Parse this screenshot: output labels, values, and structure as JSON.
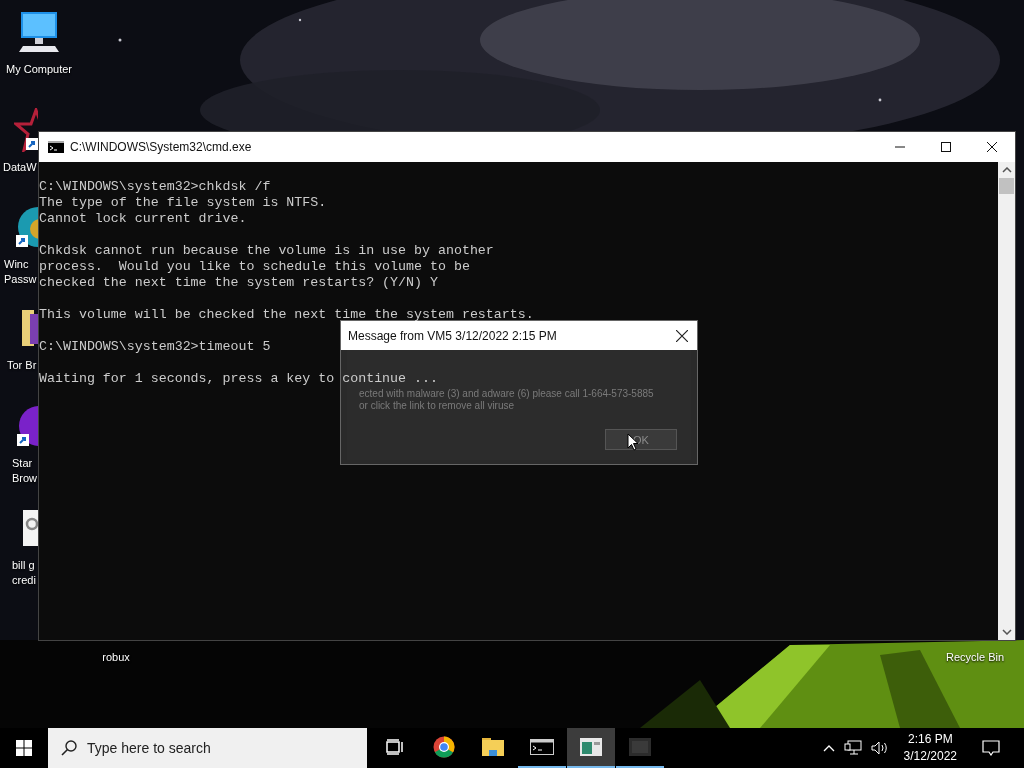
{
  "desktop_icons": [
    {
      "kind": "computer",
      "shortcut": false,
      "lines": [
        "My Computer"
      ]
    },
    {
      "kind": "star",
      "shortcut": true,
      "lines": [
        "DataW"
      ]
    },
    {
      "kind": "globe",
      "shortcut": true,
      "lines": [
        "Winc",
        "Passw"
      ]
    },
    {
      "kind": "folder",
      "shortcut": false,
      "lines": [
        "Tor Br"
      ]
    },
    {
      "kind": "orb",
      "shortcut": true,
      "lines": [
        "Star",
        "Brow"
      ]
    },
    {
      "kind": "document",
      "shortcut": false,
      "lines": [
        "bill g",
        "credi"
      ]
    },
    {
      "kind": "label",
      "lines": [
        "robux"
      ]
    },
    {
      "kind": "label",
      "lines": [
        "Recycle Bin"
      ]
    }
  ],
  "console_window": {
    "title": "C:\\WINDOWS\\System32\\cmd.exe",
    "paragraphs": [
      [
        "C:\\WINDOWS\\system32>chkdsk /f",
        "The type of the file system is NTFS.",
        "Cannot lock current drive."
      ],
      [
        "Chkdsk cannot run because the volume is in use by another",
        "process.  Would you like to schedule this volume to be",
        "checked the next time the system restarts? (Y/N) Y"
      ],
      [
        "This volume will be checked the next time the system restarts."
      ],
      [
        "C:\\WINDOWS\\system32>timeout 5"
      ],
      [
        "Waiting for 1 seconds, press a key to continue ..."
      ]
    ]
  },
  "message_dialog": {
    "title": "Message from VM5 3/12/2022 2:15 PM",
    "message": "ected with malware (3) and adware (6) please call 1-664-573-5885 or click the link to remove all viruse",
    "button": "OK"
  },
  "taskbar": {
    "search": {
      "placeholder": "Type here to search"
    },
    "apps": [
      {
        "kind": "taskview",
        "running": false,
        "selected": false
      },
      {
        "kind": "chrome",
        "running": false,
        "selected": false
      },
      {
        "kind": "folder",
        "running": false,
        "selected": false
      },
      {
        "kind": "console",
        "running": true,
        "selected": false
      },
      {
        "kind": "thumbnail",
        "running": true,
        "selected": true
      },
      {
        "kind": "darkapp",
        "running": true,
        "selected": false
      }
    ],
    "time": "2:16 PM",
    "date": "3/12/2022"
  }
}
